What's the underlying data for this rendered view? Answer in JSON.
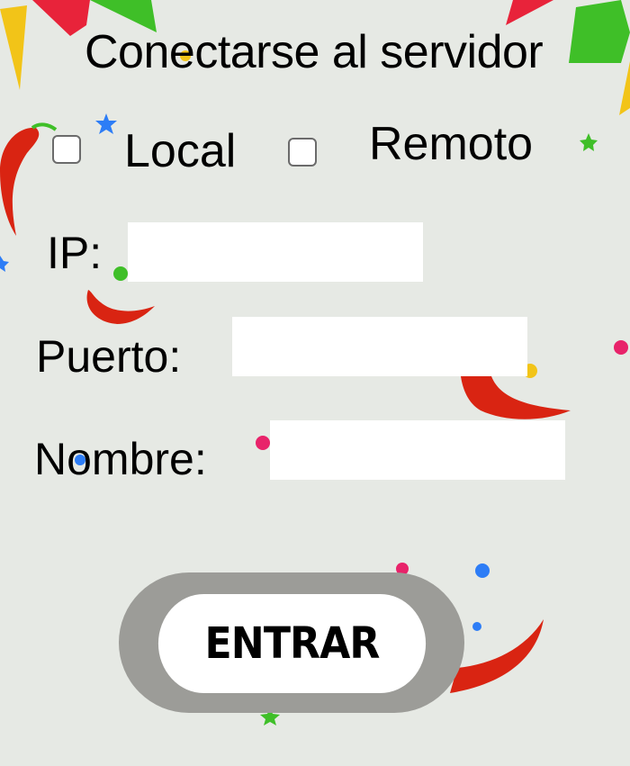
{
  "title": "Conectarse al servidor",
  "options": {
    "local_label": "Local",
    "remote_label": "Remoto"
  },
  "form": {
    "ip_label": "IP:",
    "ip_value": "",
    "port_label": "Puerto:",
    "port_value": "",
    "name_label": "Nombre:",
    "name_value": ""
  },
  "submit_label": "ENTRAR",
  "colors": {
    "background": "#e6e9e4",
    "button_ring": "#9c9c98",
    "bunting": [
      "#f2c418",
      "#e8233a",
      "#3fbf28"
    ],
    "chili": "#d92412"
  }
}
